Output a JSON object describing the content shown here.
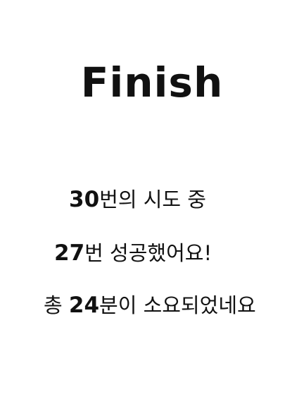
{
  "result": {
    "title": "Finish",
    "attempts_number": "30",
    "attempts_text": "번의 시도 중",
    "success_number": "27",
    "success_text": "번 성공했어요!",
    "time_prefix": "총 ",
    "time_number": "24",
    "time_text": "분이 소요되었네요"
  }
}
